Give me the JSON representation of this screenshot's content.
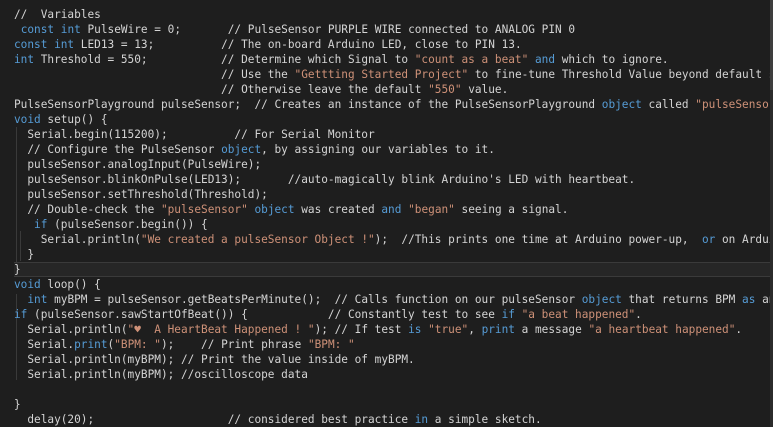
{
  "editor": {
    "lines": [
      "//  Variables",
      "const int PulseWire = 0;       // PulseSensor PURPLE WIRE connected to ANALOG PIN 0",
      "const int LED13 = 13;          // The on-board Arduino LED, close to PIN 13.",
      "int Threshold = 550;           // Determine which Signal to \"count as a beat\" and which to ignore.",
      "                               // Use the \"Gettting Started Project\" to fine-tune Threshold Value beyond default setting.",
      "                               // Otherwise leave the default \"550\" value.",
      "PulseSensorPlayground pulseSensor;  // Creates an instance of the PulseSensorPlayground object called \"pulseSensor\"",
      "void setup() {",
      "  Serial.begin(115200);          // For Serial Monitor",
      "  // Configure the PulseSensor object, by assigning our variables to it.",
      "  pulseSensor.analogInput(PulseWire);",
      "  pulseSensor.blinkOnPulse(LED13);       //auto-magically blink Arduino's LED with heartbeat.",
      "  pulseSensor.setThreshold(Threshold);",
      "  // Double-check the \"pulseSensor\" object was created and \"began\" seeing a signal.",
      "   if (pulseSensor.begin()) {",
      "    Serial.println(\"We created a pulseSensor Object !\");  //This prints one time at Arduino power-up,  or on Arduino reset.",
      "  }",
      "}",
      "void loop() {",
      "  int myBPM = pulseSensor.getBeatsPerMinute();  // Calls function on our pulseSensor object that returns BPM as an \"int\".",
      "if (pulseSensor.sawStartOfBeat()) {            // Constantly test to see if \"a beat happened\".",
      "  Serial.println(\"♥  A HeartBeat Happened ! \"); // If test is \"true\", print a message \"a heartbeat happened\".",
      "  Serial.print(\"BPM: \");    // Print phrase \"BPM: \"",
      "  Serial.println(myBPM); // Print the value inside of myBPM.",
      "  Serial.println(myBPM); //oscilloscope data",
      "",
      "}",
      "  delay(20);                    // considered best practice in a simple sketch."
    ]
  }
}
